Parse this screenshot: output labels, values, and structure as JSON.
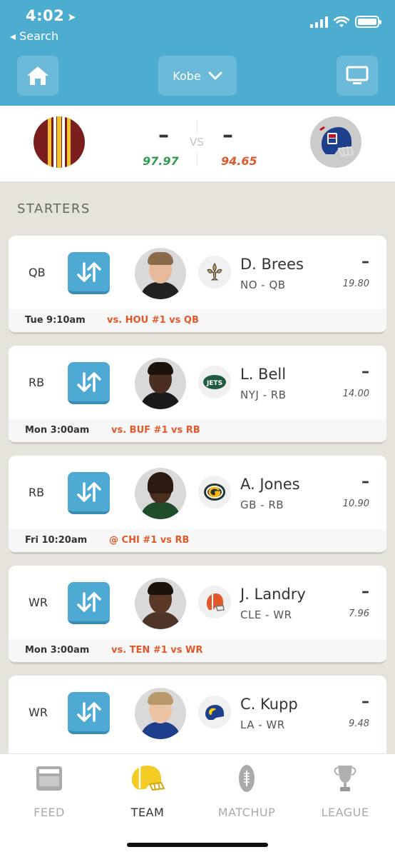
{
  "status": {
    "time": "4:02",
    "back_label": "◂ Search"
  },
  "header": {
    "team_selector": "Kobe"
  },
  "matchup": {
    "home_score": "–",
    "away_score": "–",
    "home_projection": "97.97",
    "away_projection": "94.65",
    "vs_label": "VS",
    "home_color": "#2e9e4a",
    "away_color": "#e2582a"
  },
  "section": {
    "title": "STARTERS"
  },
  "players": [
    {
      "slot": "QB",
      "name": "D. Brees",
      "team_pos": "NO - QB",
      "score": "–",
      "projection": "19.80",
      "game_time": "Tue 9:10am",
      "opponent": "vs. HOU #1 vs QB",
      "team_icon": "saints-icon"
    },
    {
      "slot": "RB",
      "name": "L. Bell",
      "team_pos": "NYJ - RB",
      "score": "–",
      "projection": "14.00",
      "game_time": "Mon 3:00am",
      "opponent": "vs. BUF #1 vs RB",
      "team_icon": "jets-icon"
    },
    {
      "slot": "RB",
      "name": "A. Jones",
      "team_pos": "GB - RB",
      "score": "–",
      "projection": "10.90",
      "game_time": "Fri 10:20am",
      "opponent": "@ CHI #1 vs RB",
      "team_icon": "packers-icon"
    },
    {
      "slot": "WR",
      "name": "J. Landry",
      "team_pos": "CLE - WR",
      "score": "–",
      "projection": "7.96",
      "game_time": "Mon 3:00am",
      "opponent": "vs. TEN #1 vs WR",
      "team_icon": "browns-icon"
    },
    {
      "slot": "WR",
      "name": "C. Kupp",
      "team_pos": "LA - WR",
      "score": "–",
      "projection": "9.48",
      "game_time": "",
      "opponent": "",
      "team_icon": "rams-icon"
    }
  ],
  "tabs": [
    {
      "label": "FEED",
      "icon": "feed-icon"
    },
    {
      "label": "TEAM",
      "icon": "helmet-icon"
    },
    {
      "label": "MATCHUP",
      "icon": "football-icon"
    },
    {
      "label": "LEAGUE",
      "icon": "trophy-icon"
    }
  ]
}
